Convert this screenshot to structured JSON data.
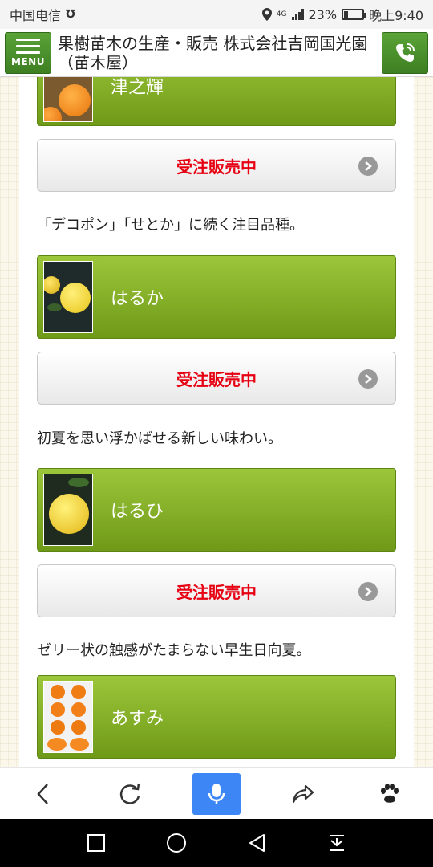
{
  "status_bar": {
    "carrier": "中国电信",
    "battery": "23%",
    "battery_level": 0.23,
    "time": "晚上9:40",
    "network": "4G"
  },
  "header": {
    "menu_label": "MENU",
    "title": "果樹苗木の生産・販売 株式会社吉岡国光園（苗木屋）"
  },
  "items": [
    {
      "name": "津之輝",
      "order_label": "受注販売中",
      "description": "「デコポン」「せとか」に続く注目品種。"
    },
    {
      "name": "はるか",
      "order_label": "受注販売中",
      "description": "初夏を思い浮かばせる新しい味わい。"
    },
    {
      "name": "はるひ",
      "order_label": "受注販売中",
      "description": "ゼリー状の触感がたまらない早生日向夏。"
    },
    {
      "name": "あすみ"
    }
  ],
  "colors": {
    "accent_green": "#6f9a18",
    "order_text": "#e60012",
    "voice_button": "#3d86f5"
  },
  "browser_toolbar": {
    "icons": [
      "back-icon",
      "refresh-icon",
      "microphone-icon",
      "share-icon",
      "paw-icon"
    ]
  },
  "nav_bar": {
    "icons": [
      "recents-icon",
      "home-icon",
      "back-triangle-icon",
      "download-icon"
    ]
  }
}
